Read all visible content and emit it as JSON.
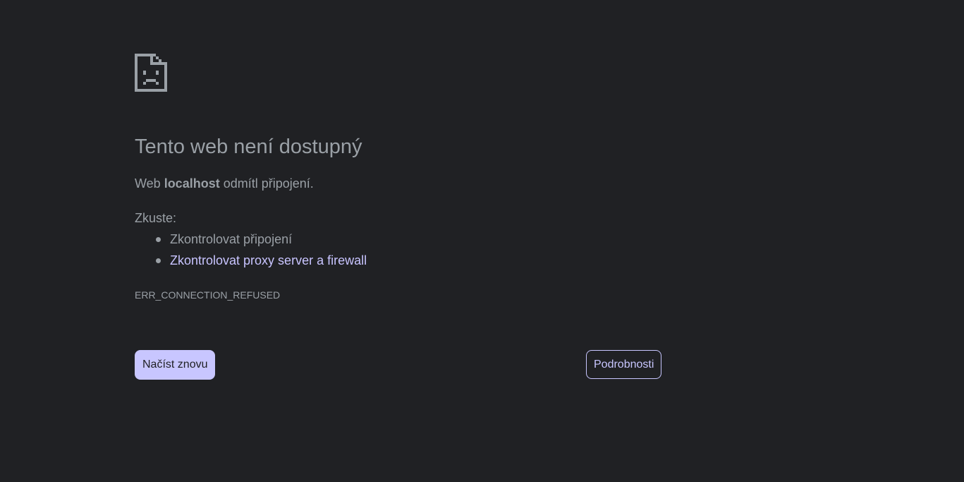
{
  "error_icon": "sad-page-icon",
  "title": "Tento web není dostupný",
  "description": {
    "prefix": "Web ",
    "host": "localhost",
    "suffix": " odmítl připojení."
  },
  "try_label": "Zkuste:",
  "suggestions": [
    {
      "text": "Zkontrolovat připojení",
      "link": false
    },
    {
      "text": "Zkontrolovat proxy server a firewall",
      "link": true
    }
  ],
  "error_code": "ERR_CONNECTION_REFUSED",
  "buttons": {
    "reload": "Načíst znovu",
    "details": "Podrobnosti"
  },
  "colors": {
    "background": "#202124",
    "text": "#9aa0a6",
    "accent": "#c8c6ff",
    "link": "#c8c4ff"
  }
}
